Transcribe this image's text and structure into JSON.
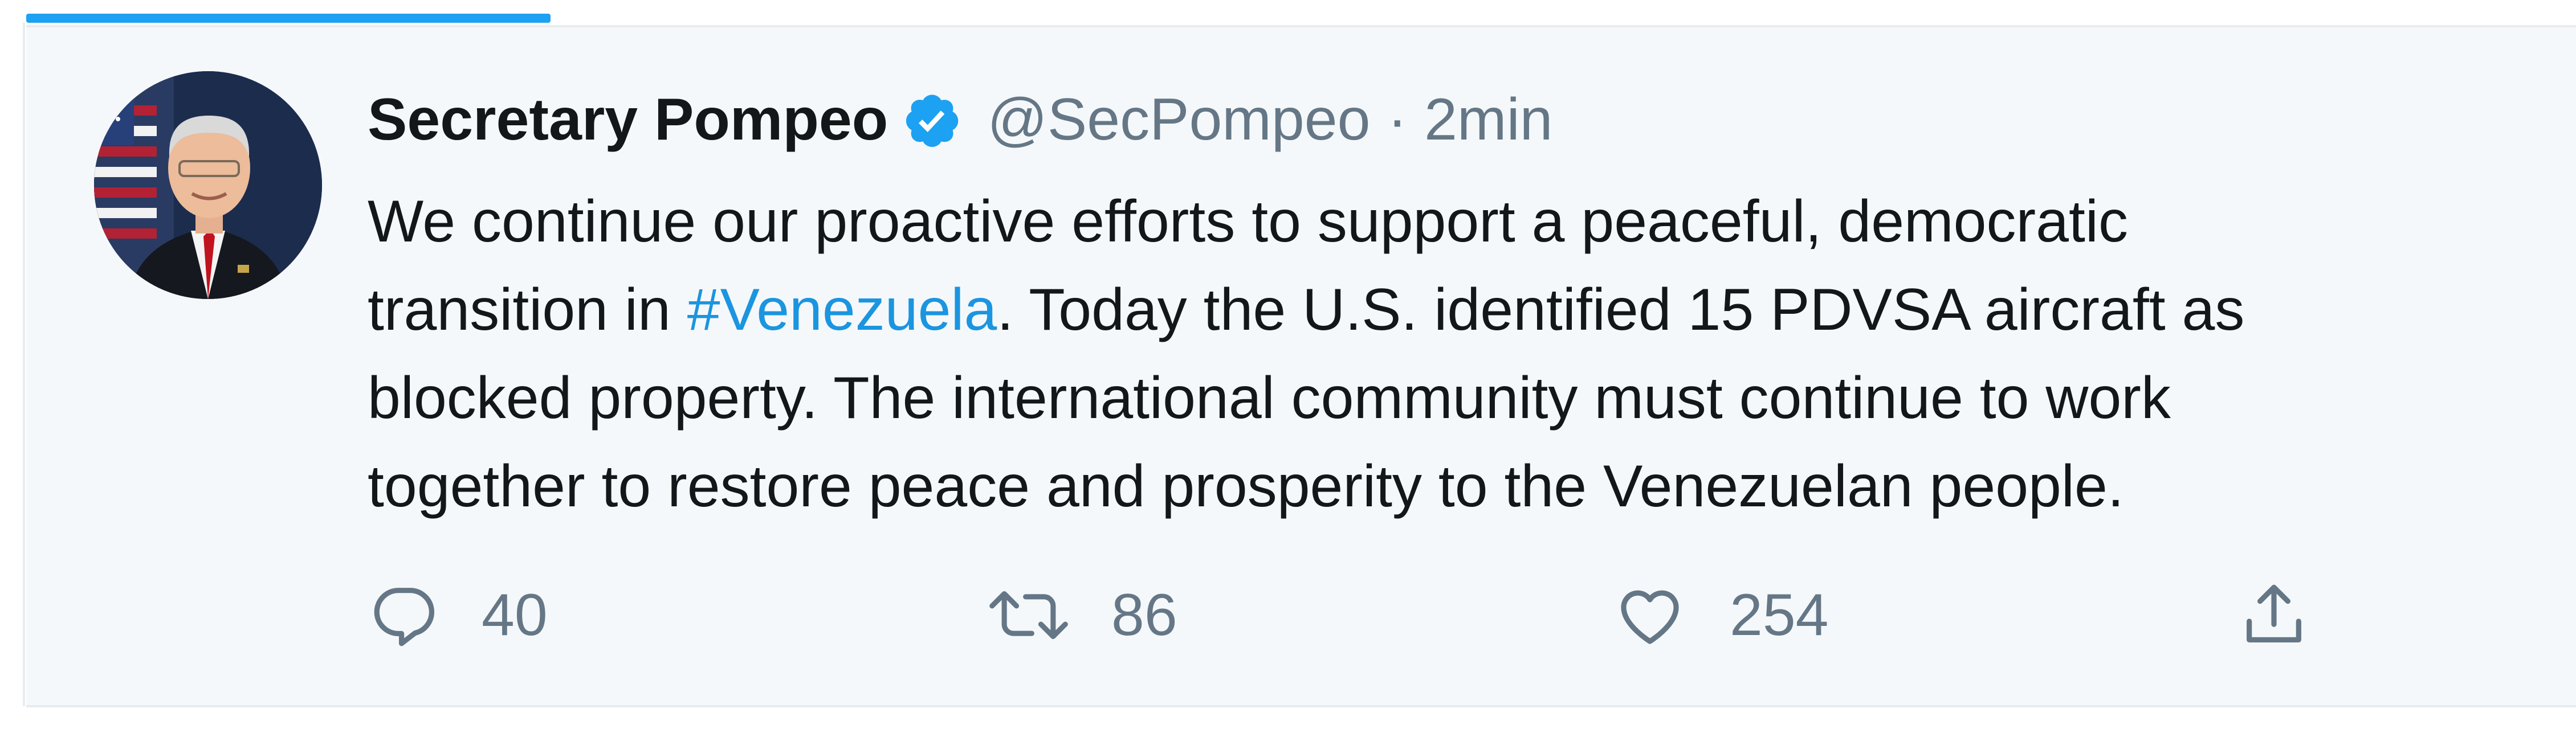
{
  "tweet": {
    "author": {
      "name": "Secretary Pompeo",
      "verified": true,
      "handle": "@SecPompeo"
    },
    "separator": "·",
    "time": "2min",
    "text": {
      "line1": "We continue our proactive efforts to support a peaceful, democratic",
      "line2_pre": "transition in ",
      "hashtag": "#Venezuela",
      "line2_post": ". Today the U.S. identified 15 PDVSA aircraft as",
      "line3": "blocked property. The international community must continue to work",
      "line4": "together to restore peace and prosperity to the Venezuelan people."
    },
    "actions": {
      "reply": {
        "icon": "reply-icon",
        "count": "40"
      },
      "retweet": {
        "icon": "retweet-icon",
        "count": "86"
      },
      "like": {
        "icon": "heart-icon",
        "count": "254"
      },
      "share": {
        "icon": "share-icon"
      }
    }
  },
  "colors": {
    "accent": "#1da1f2",
    "hashtag": "#1b95e0",
    "text": "#14171a",
    "secondary_text": "#657786",
    "tweet_background": "#f5f8fa",
    "border": "#e6ecf0"
  }
}
